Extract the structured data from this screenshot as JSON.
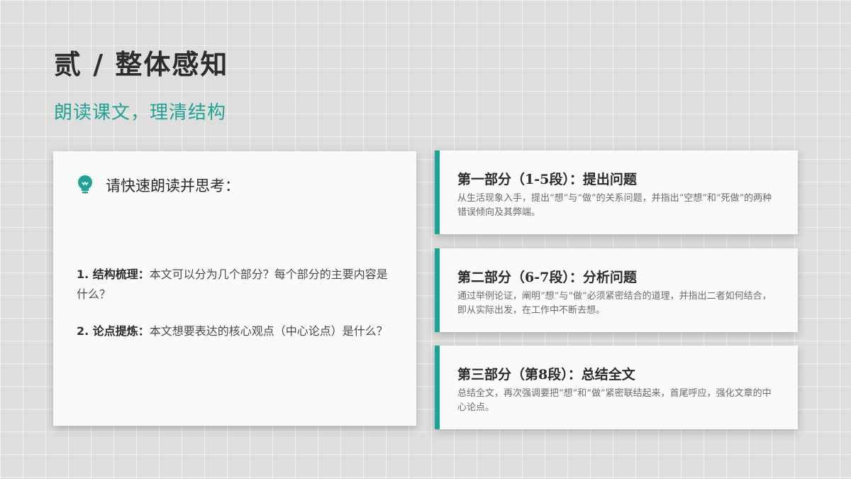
{
  "header": {
    "title": "贰 / 整体感知",
    "subtitle": "朗读课文，理清结构"
  },
  "prompt": {
    "heading": "请快速朗读并思考：",
    "icon": "lightbulb-icon",
    "questions": [
      {
        "num": "1. ",
        "label": "结构梳理：",
        "text": "本文可以分为几个部分？每个部分的主要内容是什么？"
      },
      {
        "num": "2. ",
        "label": "论点提炼：",
        "text": "本文想要表达的核心观点（中心论点）是什么？"
      }
    ]
  },
  "parts": [
    {
      "title": "第一部分（1-5段）：提出问题",
      "desc": "从生活现象入手，提出“想”与“做”的关系问题，并指出“空想”和“死做”的两种错误倾向及其弊端。"
    },
    {
      "title": "第二部分（6-7段）：分析问题",
      "desc": "通过举例论证，阐明“想”与“做”必须紧密结合的道理，并指出二者如何结合，即从实际出发，在工作中不断去想。"
    },
    {
      "title": "第三部分（第8段）：总结全文",
      "desc": "总结全文，再次强调要把“想”和“做”紧密联结起来，首尾呼应，强化文章的中心论点。"
    }
  ],
  "colors": {
    "accent": "#1fa396",
    "background": "#dededc",
    "card": "#fafafa"
  }
}
